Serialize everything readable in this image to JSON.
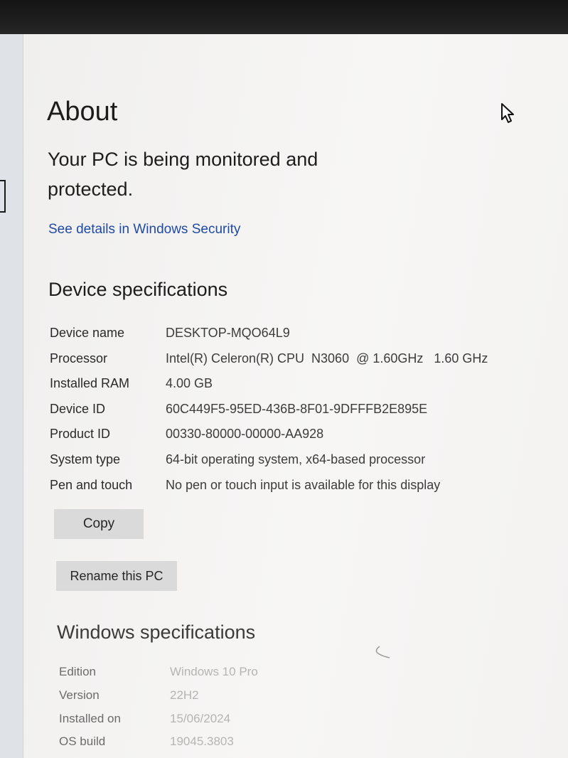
{
  "page": {
    "title": "About"
  },
  "security": {
    "message": "Your PC is being monitored and protected.",
    "link_label": "See details in Windows Security",
    "link_color": "#1f4aa3"
  },
  "device_specs": {
    "heading": "Device specifications",
    "rows": [
      {
        "label": "Device name",
        "value": "DESKTOP-MQO64L9"
      },
      {
        "label": "Processor",
        "value": "Intel(R) Celeron(R) CPU  N3060  @ 1.60GHz   1.60 GHz"
      },
      {
        "label": "Installed RAM",
        "value": "4.00 GB"
      },
      {
        "label": "Device ID",
        "value": "60C449F5-95ED-436B-8F01-9DFFFB2E895E"
      },
      {
        "label": "Product ID",
        "value": "00330-80000-00000-AA928"
      },
      {
        "label": "System type",
        "value": "64-bit operating system, x64-based processor"
      },
      {
        "label": "Pen and touch",
        "value": "No pen or touch input is available for this display"
      }
    ],
    "copy_label": "Copy",
    "rename_label": "Rename this PC"
  },
  "windows_specs": {
    "heading": "Windows specifications",
    "rows": [
      {
        "label": "Edition",
        "value": "Windows 10 Pro"
      },
      {
        "label": "Version",
        "value": "22H2"
      },
      {
        "label": "Installed on",
        "value": "15/06/2024"
      },
      {
        "label": "OS build",
        "value": "19045.3803"
      }
    ]
  },
  "icons": {
    "cursor": "mouse-pointer-icon"
  }
}
